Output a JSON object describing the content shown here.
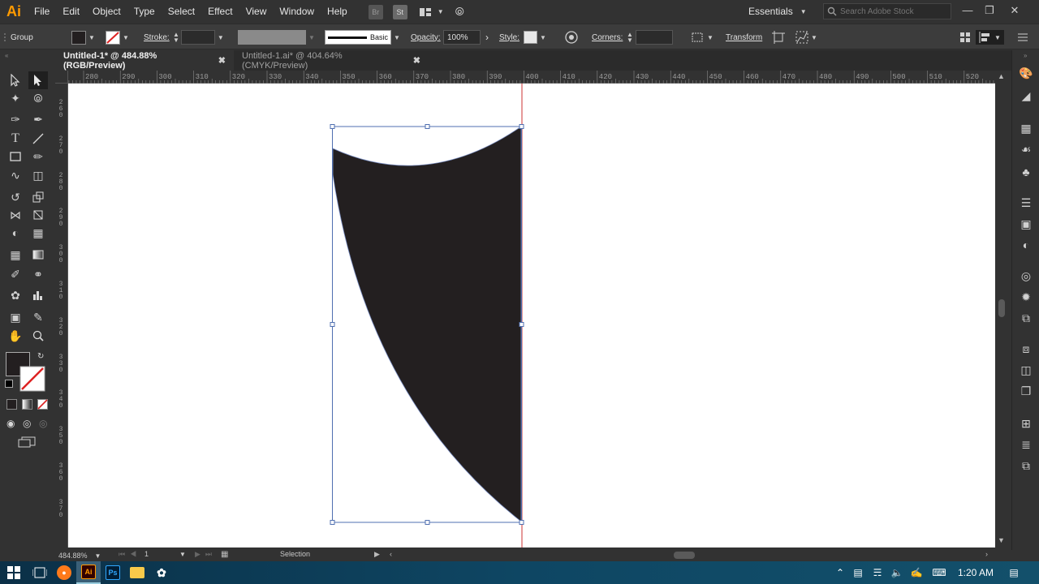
{
  "app": {
    "logo": "Ai"
  },
  "menu": [
    "File",
    "Edit",
    "Object",
    "Type",
    "Select",
    "Effect",
    "View",
    "Window",
    "Help"
  ],
  "menu_buttons": {
    "bridge": "Br",
    "stock": "St"
  },
  "workspace": {
    "label": "Essentials"
  },
  "search": {
    "placeholder": "Search Adobe Stock"
  },
  "control": {
    "selection_type": "Group",
    "stroke_label": "Stroke:",
    "brush_label": "Basic",
    "opacity_label": "Opacity:",
    "opacity_value": "100%",
    "style_label": "Style:",
    "corners_label": "Corners:",
    "transform_label": "Transform"
  },
  "tabs": [
    {
      "label": "Untitled-1* @ 484.88% (RGB/Preview)"
    },
    {
      "label": "Untitled-1.ai* @ 404.64% (CMYK/Preview)"
    }
  ],
  "ruler_top": [
    "280",
    "290",
    "300",
    "310",
    "320",
    "330",
    "340",
    "350",
    "360",
    "370",
    "380",
    "390",
    "400",
    "410",
    "420",
    "430",
    "440",
    "450",
    "460",
    "470",
    "480",
    "490",
    "500",
    "510",
    "520"
  ],
  "ruler_left": [
    "2\n6\n0",
    "2\n7\n0",
    "2\n8\n0",
    "2\n9\n0",
    "3\n0\n0",
    "3\n1\n0",
    "3\n2\n0",
    "3\n3\n0",
    "3\n4\n0",
    "3\n5\n0",
    "3\n6\n0",
    "3\n7\n0"
  ],
  "status": {
    "zoom": "484.88%",
    "artboard": "1",
    "tool": "Selection"
  },
  "colors": {
    "fill": "#231f20",
    "canvas": "#ffffff",
    "guide": "#cc3333",
    "bbox": "#4f6fb0",
    "accent": "#ff9a00"
  },
  "taskbar": {
    "time": "1:20 AM",
    "apps": [
      "windows-start",
      "task-view",
      "firefox",
      "illustrator",
      "photoshop",
      "file-explorer",
      "network-app"
    ]
  }
}
